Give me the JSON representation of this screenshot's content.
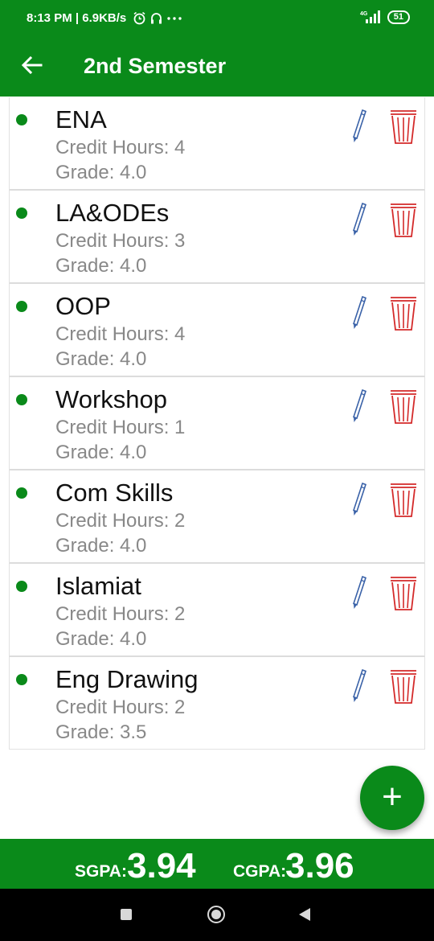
{
  "status_bar": {
    "time_speed": "8:13 PM | 6.9KB/s",
    "network": "4G",
    "battery": "51",
    "icons": [
      "alarm-icon",
      "headset-icon",
      "more-dots-icon",
      "signal-icon"
    ]
  },
  "app_bar": {
    "title": "2nd Semester",
    "back_icon": "arrow-left-icon"
  },
  "courses": [
    {
      "name": "ENA",
      "credit": "Credit Hours: 4",
      "grade": "Grade: 4.0"
    },
    {
      "name": "LA&ODEs",
      "credit": "Credit Hours: 3",
      "grade": "Grade: 4.0"
    },
    {
      "name": "OOP",
      "credit": "Credit Hours: 4",
      "grade": "Grade: 4.0"
    },
    {
      "name": "Workshop",
      "credit": "Credit Hours: 1",
      "grade": "Grade: 4.0"
    },
    {
      "name": "Com Skills",
      "credit": "Credit Hours: 2",
      "grade": "Grade: 4.0"
    },
    {
      "name": "Islamiat",
      "credit": "Credit Hours: 2",
      "grade": "Grade: 4.0"
    },
    {
      "name": "Eng Drawing",
      "credit": "Credit Hours: 2",
      "grade": "Grade: 3.5"
    }
  ],
  "fab": {
    "label": "+"
  },
  "gpa": {
    "sgpa_label": "SGPA:",
    "sgpa_value": "3.94",
    "cgpa_label": "CGPA:",
    "cgpa_value": "3.96"
  },
  "colors": {
    "primary": "#0a8a1a",
    "edit_icon": "#3a62a8",
    "delete_icon": "#d42a2a",
    "secondary_text": "#888888"
  }
}
